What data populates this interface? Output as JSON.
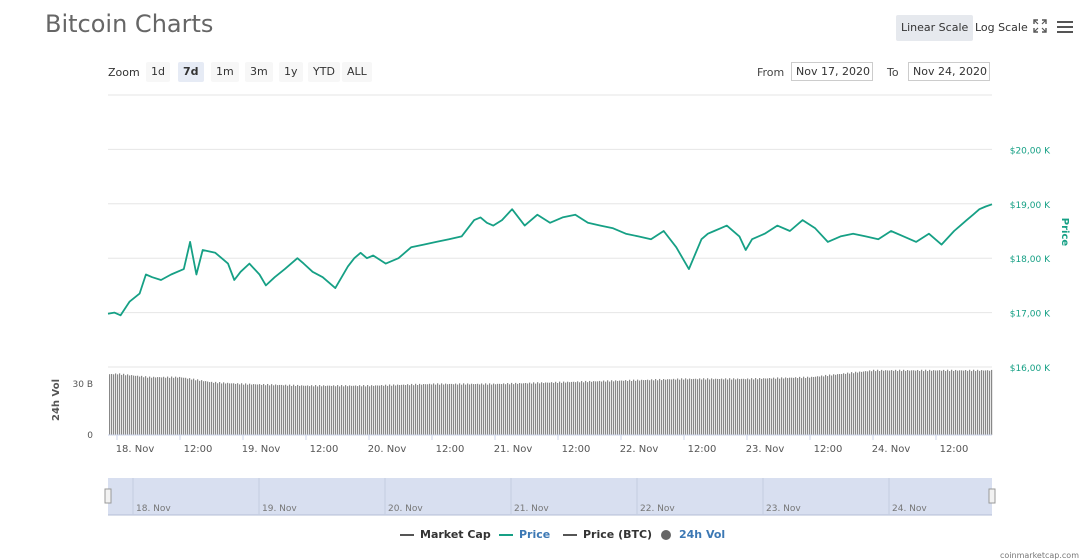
{
  "header": {
    "title": "Bitcoin Charts",
    "linear_scale": "Linear Scale",
    "log_scale": "Log Scale"
  },
  "zoom": {
    "label": "Zoom",
    "options": [
      "1d",
      "7d",
      "1m",
      "3m",
      "1y",
      "YTD",
      "ALL"
    ],
    "selected": "7d"
  },
  "range": {
    "from_label": "From",
    "from_value": "Nov 17, 2020",
    "to_label": "To",
    "to_value": "Nov 24, 2020"
  },
  "legend": {
    "items": [
      {
        "label": "Market Cap",
        "color": "#555555"
      },
      {
        "label": "Price",
        "color": "#16a085"
      },
      {
        "label": "Price (BTC)",
        "color": "#555555"
      },
      {
        "label": "24h Vol",
        "color": "#666666"
      }
    ]
  },
  "footer": {
    "credit": "coinmarketcap.com"
  },
  "colors": {
    "price": "#16a085",
    "volume": "#888888",
    "navigator": "#d8dff0"
  },
  "chart_data": {
    "type": "line",
    "y_axis": {
      "title": "Price",
      "ticks": [
        16000,
        17000,
        18000,
        19000,
        20000
      ],
      "tick_labels": [
        "$16,00 K",
        "$17,00 K",
        "$18,00 K",
        "$19,00 K",
        "$20,00 K"
      ],
      "range": [
        16000,
        21000
      ],
      "position": "right"
    },
    "volume_axis": {
      "title": "24h Vol",
      "ticks": [
        0,
        30
      ],
      "tick_labels": [
        "0",
        "30 B"
      ],
      "range": [
        0,
        40
      ],
      "position": "left"
    },
    "x_axis": {
      "range_days": [
        "Nov 17, 2020",
        "Nov 24, 2020"
      ],
      "tick_labels": [
        "18. Nov",
        "12:00",
        "19. Nov",
        "12:00",
        "20. Nov",
        "12:00",
        "21. Nov",
        "12:00",
        "22. Nov",
        "12:00",
        "23. Nov",
        "12:00",
        "24. Nov",
        "12:00"
      ]
    },
    "navigator_labels": [
      "18. Nov",
      "19. Nov",
      "20. Nov",
      "21. Nov",
      "22. Nov",
      "23. Nov",
      "24. Nov"
    ],
    "series": [
      {
        "name": "Price",
        "x_days": [
          0,
          0.05,
          0.1,
          0.17,
          0.25,
          0.3,
          0.35,
          0.42,
          0.5,
          0.6,
          0.65,
          0.7,
          0.75,
          0.85,
          0.9,
          0.95,
          1.0,
          1.05,
          1.12,
          1.2,
          1.25,
          1.32,
          1.4,
          1.5,
          1.55,
          1.62,
          1.7,
          1.8,
          1.9,
          1.95,
          2.0,
          2.05,
          2.1,
          2.2,
          2.3,
          2.4,
          2.5,
          2.6,
          2.7,
          2.8,
          2.9,
          2.95,
          3.0,
          3.05,
          3.12,
          3.2,
          3.3,
          3.4,
          3.5,
          3.6,
          3.7,
          3.8,
          3.9,
          4.0,
          4.1,
          4.2,
          4.3,
          4.4,
          4.5,
          4.6,
          4.7,
          4.75,
          4.8,
          4.85,
          4.9,
          5.0,
          5.05,
          5.1,
          5.2,
          5.3,
          5.4,
          5.5,
          5.6,
          5.7,
          5.8,
          5.9,
          6.0,
          6.1,
          6.2,
          6.3,
          6.4,
          6.5,
          6.6,
          6.7,
          6.75,
          6.8,
          6.85,
          6.9,
          6.95,
          7.0
        ],
        "y": [
          16980,
          17000,
          16950,
          17200,
          17350,
          17700,
          17650,
          17600,
          17700,
          17800,
          18300,
          17700,
          18150,
          18100,
          18000,
          17900,
          17600,
          17750,
          17900,
          17700,
          17500,
          17650,
          17800,
          18000,
          17900,
          17750,
          17650,
          17450,
          17850,
          18000,
          18100,
          18000,
          18050,
          17900,
          18000,
          18200,
          18250,
          18300,
          18350,
          18400,
          18700,
          18750,
          18650,
          18600,
          18700,
          18900,
          18600,
          18800,
          18650,
          18750,
          18800,
          18650,
          18600,
          18550,
          18450,
          18400,
          18350,
          18500,
          18200,
          17800,
          18350,
          18450,
          18500,
          18550,
          18600,
          18400,
          18150,
          18350,
          18450,
          18600,
          18500,
          18700,
          18550,
          18300,
          18400,
          18450,
          18400,
          18350,
          18500,
          18400,
          18300,
          18450,
          18250,
          18500,
          18600,
          18700,
          18800,
          18900,
          18950,
          18990
        ]
      },
      {
        "name": "24h Vol",
        "x_days": [
          0,
          0.5,
          0.75,
          1.0,
          1.25,
          1.5,
          1.75,
          2.0,
          2.5,
          3.0,
          3.5,
          4.0,
          4.5,
          5.0,
          5.5,
          6.0,
          6.5,
          6.75,
          7.0
        ],
        "y": [
          31,
          32,
          35,
          36,
          34,
          34,
          31,
          30,
          29,
          29,
          30,
          30,
          31,
          32,
          33,
          33,
          34,
          36,
          38
        ]
      }
    ],
    "grid": true,
    "legend_position": "bottom-center"
  }
}
